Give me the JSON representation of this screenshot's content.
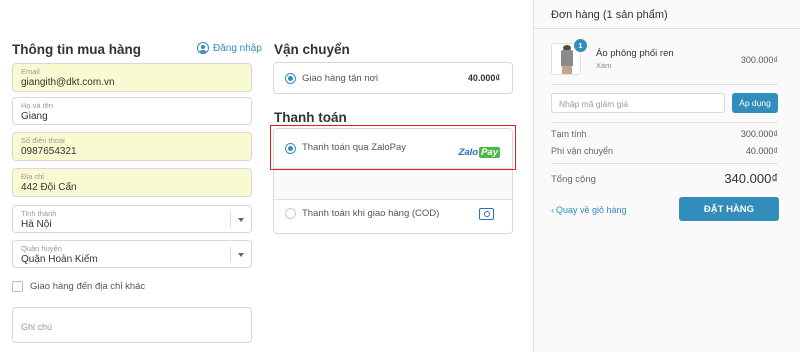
{
  "customer": {
    "title": "Thông tin mua hàng",
    "login_label": "Đăng nhập",
    "email": {
      "label": "Email",
      "value": "giangith@dkt.com.vn"
    },
    "name": {
      "label": "Họ và tên",
      "value": "Giang"
    },
    "phone": {
      "label": "Số điện thoại",
      "value": "0987654321"
    },
    "address": {
      "label": "Địa chỉ",
      "value": "442 Đội Cấn"
    },
    "province": {
      "label": "Tỉnh thành",
      "value": "Hà Nội"
    },
    "district": {
      "label": "Quận huyện",
      "value": "Quận Hoàn Kiếm"
    },
    "ship_other_label": "Giao hàng đến địa chỉ khác",
    "note_placeholder": "Ghi chú"
  },
  "shipping": {
    "title": "Vận chuyển",
    "option": {
      "label": "Giao hàng tận nơi",
      "price": "40.000₫"
    }
  },
  "payment": {
    "title": "Thanh toán",
    "options": [
      {
        "label": "Thanh toán qua ZaloPay",
        "logo_zalo": "Zalo",
        "logo_pay": "Pay",
        "selected": true
      },
      {
        "label": "Thanh toán khi giao hàng (COD)",
        "selected": false
      }
    ]
  },
  "order": {
    "title": "Đơn hàng (1 sản phẩm)",
    "product": {
      "name": "Áo phông phối ren",
      "variant": "Xám",
      "price": "300.000₫",
      "quantity": "1"
    },
    "discount_placeholder": "Nhập mã giảm giá",
    "apply_label": "Áp dụng",
    "subtotal_label": "Tạm tính",
    "subtotal_value": "300.000₫",
    "shipping_fee_label": "Phí vận chuyển",
    "shipping_fee_value": "40.000₫",
    "total_label": "Tổng cộng",
    "total_value": "340.000₫",
    "back_label": "Quay về giỏ hàng",
    "place_order_label": "ĐẶT HÀNG"
  },
  "colors": {
    "accent": "#338dbc",
    "highlight": "#e02020",
    "filled_field": "#fafad2"
  }
}
